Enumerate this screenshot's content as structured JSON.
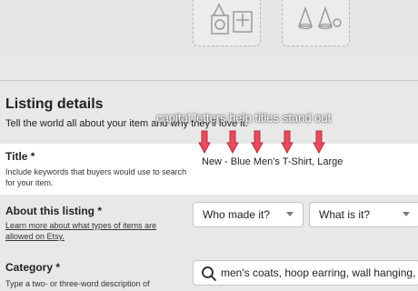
{
  "listing": {
    "heading": "Listing details",
    "subtitle": "Tell the world all about your item and why they'll love it.",
    "overlay_caption": "capital letters help titles stand out"
  },
  "title_field": {
    "label": "Title *",
    "help": "Include keywords that buyers would use to search for your item.",
    "value": "New - Blue Men's T-Shirt, Large"
  },
  "about_field": {
    "label": "About this listing *",
    "help_link": "Learn more about what types of items are allowed on Etsy.",
    "who_made_select": "Who made it?",
    "what_is_select": "What is it?"
  },
  "category_field": {
    "label": "Category *",
    "help": "Type a two- or three-word description of",
    "search_placeholder": "men's coats, hoop earring, wall hanging, yarn"
  },
  "colors": {
    "arrow": "#e84a5f",
    "arrow_outline": "#b8303f"
  },
  "icons": [
    "photo-upload-icon",
    "cone-shapes-icon",
    "search-icon",
    "chevron-down-icon",
    "down-arrow-icon"
  ]
}
